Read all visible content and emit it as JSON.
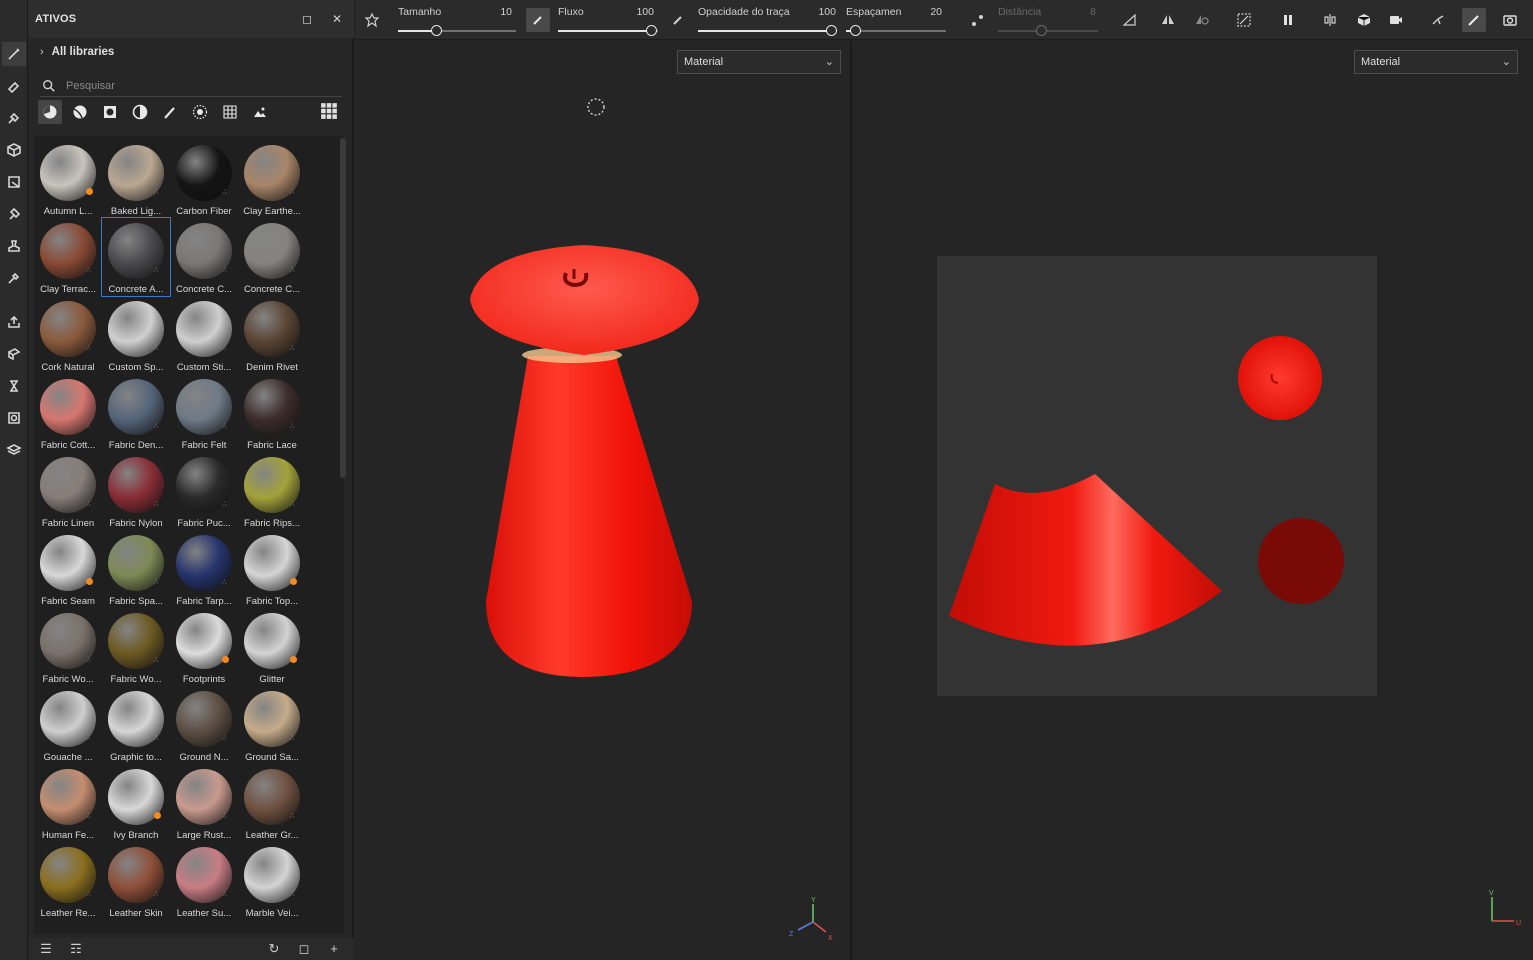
{
  "assets_panel": {
    "title": "ATIVOS",
    "library": "All libraries",
    "search_placeholder": "Pesquisar",
    "items": [
      {
        "label": "Autumn L...",
        "color": "#c8c3bd"
      },
      {
        "label": "Baked Lig...",
        "color": "#b9a892"
      },
      {
        "label": "Carbon Fiber",
        "color": "#141414"
      },
      {
        "label": "Clay Earthe...",
        "color": "#a88568"
      },
      {
        "label": "Clay Terrac...",
        "color": "#8a4a35"
      },
      {
        "label": "Concrete A...",
        "color": "#4a4a4e"
      },
      {
        "label": "Concrete C...",
        "color": "#7a7877"
      },
      {
        "label": "Concrete C...",
        "color": "#858380"
      },
      {
        "label": "Cork Natural",
        "color": "#8a5a3c"
      },
      {
        "label": "Custom Sp...",
        "color": "#d0d0d0"
      },
      {
        "label": "Custom Sti...",
        "color": "#cfcfcf"
      },
      {
        "label": "Denim Rivet",
        "color": "#5a4433"
      },
      {
        "label": "Fabric Cott...",
        "color": "#d6776f"
      },
      {
        "label": "Fabric Den...",
        "color": "#55657a"
      },
      {
        "label": "Fabric Felt",
        "color": "#6e7a86"
      },
      {
        "label": "Fabric Lace",
        "color": "#3c2e2c"
      },
      {
        "label": "Fabric Linen",
        "color": "#867d78"
      },
      {
        "label": "Fabric Nylon",
        "color": "#8a2d36"
      },
      {
        "label": "Fabric Puc...",
        "color": "#2a2a2a"
      },
      {
        "label": "Fabric Rips...",
        "color": "#a3a33a"
      },
      {
        "label": "Fabric Seam",
        "color": "#d8d8d8"
      },
      {
        "label": "Fabric Spa...",
        "color": "#7d8a55"
      },
      {
        "label": "Fabric Tarp...",
        "color": "#25346d"
      },
      {
        "label": "Fabric Top...",
        "color": "#d5d5d5"
      },
      {
        "label": "Fabric Wo...",
        "color": "#7a716a"
      },
      {
        "label": "Fabric Wo...",
        "color": "#6d5a22"
      },
      {
        "label": "Footprints",
        "color": "#dcdcdc"
      },
      {
        "label": "Glitter",
        "color": "#d3d3d3"
      },
      {
        "label": "Gouache ...",
        "color": "#cfcfcf"
      },
      {
        "label": "Graphic to...",
        "color": "#d6d6d6"
      },
      {
        "label": "Ground N...",
        "color": "#5c4f44"
      },
      {
        "label": "Ground Sa...",
        "color": "#c5ab8a"
      },
      {
        "label": "Human Fe...",
        "color": "#c48d70"
      },
      {
        "label": "Ivy Branch",
        "color": "#d8d8d8"
      },
      {
        "label": "Large Rust...",
        "color": "#c89a8e"
      },
      {
        "label": "Leather Gr...",
        "color": "#6f5140"
      },
      {
        "label": "Leather Re...",
        "color": "#8a6f1e"
      },
      {
        "label": "Leather Skin",
        "color": "#8f4f39"
      },
      {
        "label": "Leather Su...",
        "color": "#c77d84"
      },
      {
        "label": "Marble Vei...",
        "color": "#d4d4d4"
      }
    ]
  },
  "toolbar": {
    "size_label": "Tamanho",
    "size_value": "10",
    "flow_label": "Fluxo",
    "flow_value": "100",
    "opacity_label": "Opacidade do traça",
    "opacity_value": "100",
    "spacing_label": "Espaçamen",
    "spacing_value": "20",
    "distance_label": "Distância",
    "distance_value": "8"
  },
  "viewport_3d": {
    "mode": "Material"
  },
  "viewport_2d": {
    "mode": "Material"
  },
  "colors": {
    "mesh_red": "#ff1a10",
    "accent_blue": "#3a79c9",
    "badge_orange": "#f58a1f"
  }
}
